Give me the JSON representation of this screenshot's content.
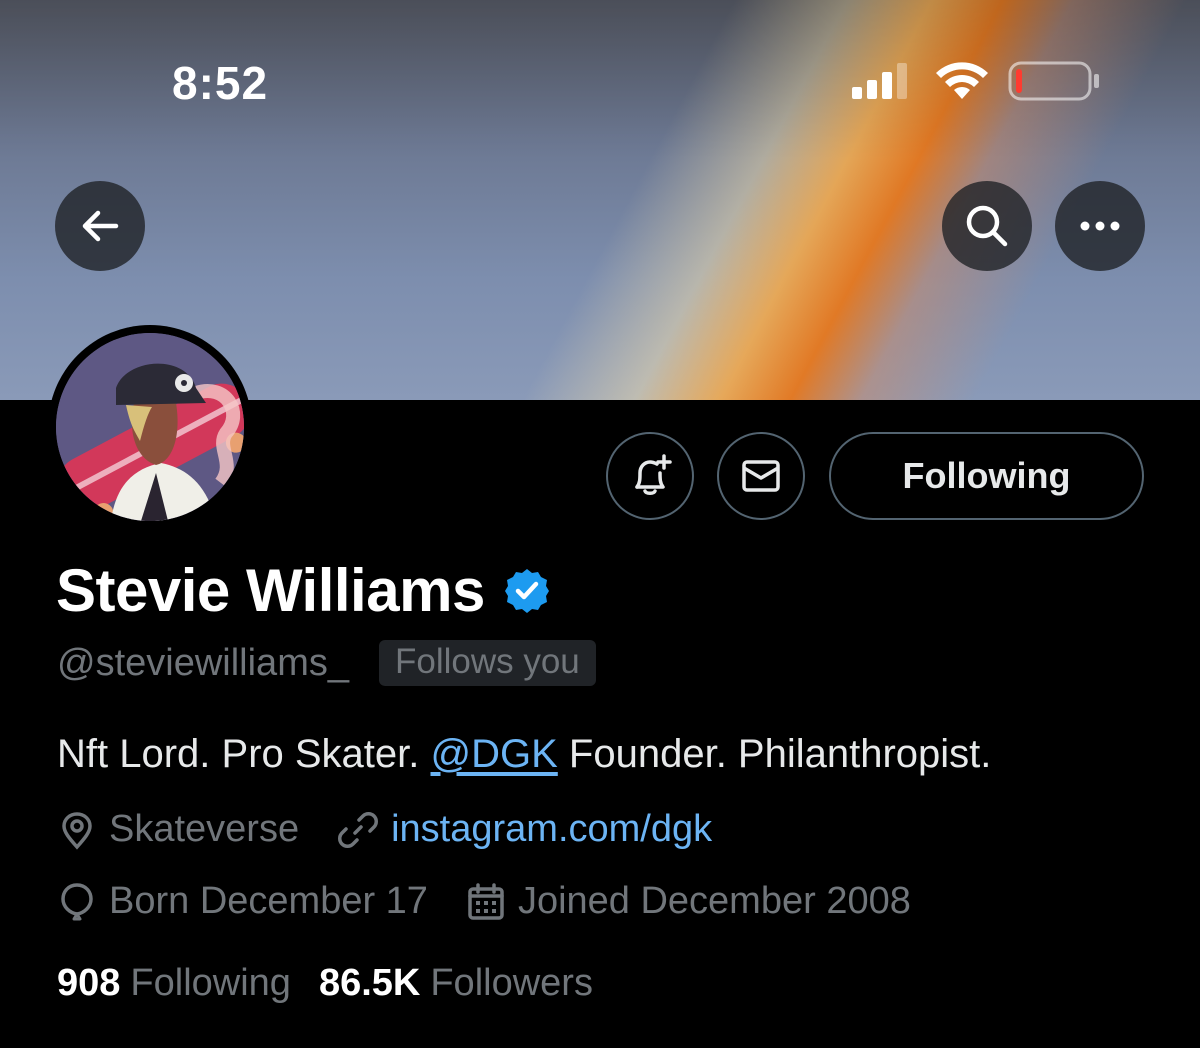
{
  "status_bar": {
    "time": "8:52"
  },
  "header": {
    "icons": [
      "back-arrow-icon",
      "search-icon",
      "more-icon"
    ]
  },
  "profile": {
    "display_name": "Stevie Williams",
    "handle": "@steviewilliams_",
    "follows_you": "Follows you",
    "bio_before": "Nft Lord. Pro Skater. ",
    "bio_mention": "@DGK",
    "bio_after": " Founder. Philanthropist.",
    "location": "Skateverse",
    "website": "instagram.com/dgk",
    "birthday": "Born December 17",
    "joined": "Joined December 2008"
  },
  "actions": {
    "following_label": "Following"
  },
  "stats": {
    "following_count": "908",
    "following_label": "Following",
    "followers_count": "86.5K",
    "followers_label": "Followers"
  },
  "colors": {
    "accent_link": "#6cb4f4",
    "verified": "#1d9bf0",
    "muted_text": "#71767b",
    "battery_low": "#ff3b30"
  }
}
